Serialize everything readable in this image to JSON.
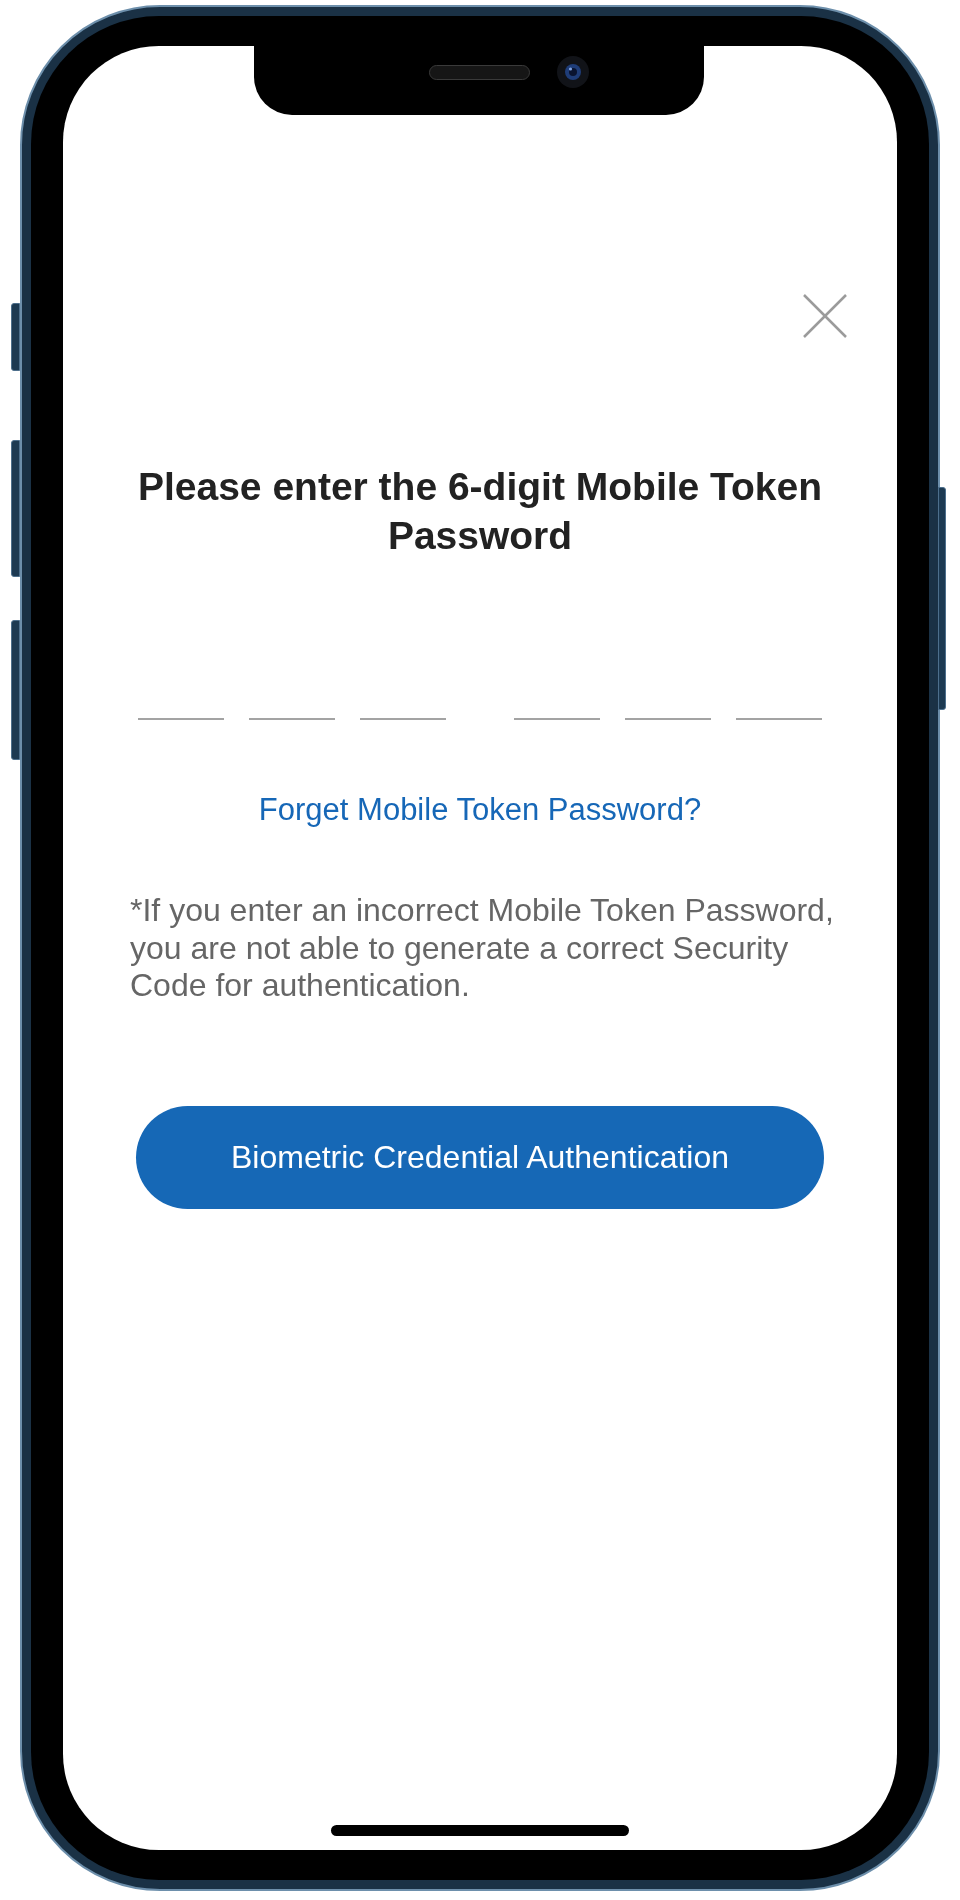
{
  "title": "Please enter the 6-digit Mobile Token Password",
  "pin_fields": {
    "groups": [
      {
        "slots": [
          {
            "filled": false
          },
          {
            "filled": false
          },
          {
            "filled": false
          }
        ]
      },
      {
        "slots": [
          {
            "filled": false
          },
          {
            "filled": false
          },
          {
            "filled": false
          }
        ]
      }
    ]
  },
  "forgot_link": "Forget Mobile Token Password?",
  "note": "*If you enter an incorrect Mobile Token Password, you are not able to generate a correct Security Code for authentication.",
  "primary_button": "Biometric Credential Authentication"
}
